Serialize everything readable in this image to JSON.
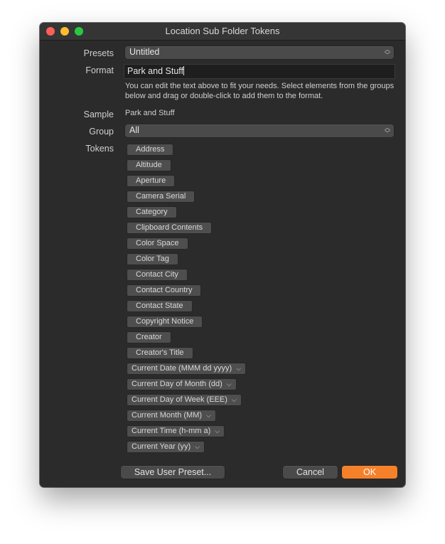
{
  "window": {
    "title": "Location Sub Folder Tokens"
  },
  "labels": {
    "presets": "Presets",
    "format": "Format",
    "sample": "Sample",
    "group": "Group",
    "tokens": "Tokens"
  },
  "presets": {
    "value": "Untitled"
  },
  "format": {
    "value": "Park and Stuff"
  },
  "help_text": "You can edit the text above to fit your needs. Select elements from the groups below and drag or double-click to add them to the format.",
  "sample": {
    "value": "Park and Stuff"
  },
  "group": {
    "value": "All"
  },
  "tokens": [
    "Address",
    "Altitude",
    "Aperture",
    "Camera Serial",
    "Category",
    "Clipboard Contents",
    "Color Space",
    "Color Tag",
    "Contact City",
    "Contact Country",
    "Contact State",
    "Copyright Notice",
    "Creator",
    "Creator's Title",
    "Current Date (MMM dd yyyy)",
    "Current Day of Month (dd)",
    "Current Day of Week (EEE)",
    "Current Month (MM)",
    "Current Time (h-mm a)",
    "Current Year (yy)"
  ],
  "buttons": {
    "save_preset": "Save User Preset...",
    "cancel": "Cancel",
    "ok": "OK"
  },
  "colors": {
    "accent": "#f5802a",
    "window_bg": "#2b2b2b"
  }
}
